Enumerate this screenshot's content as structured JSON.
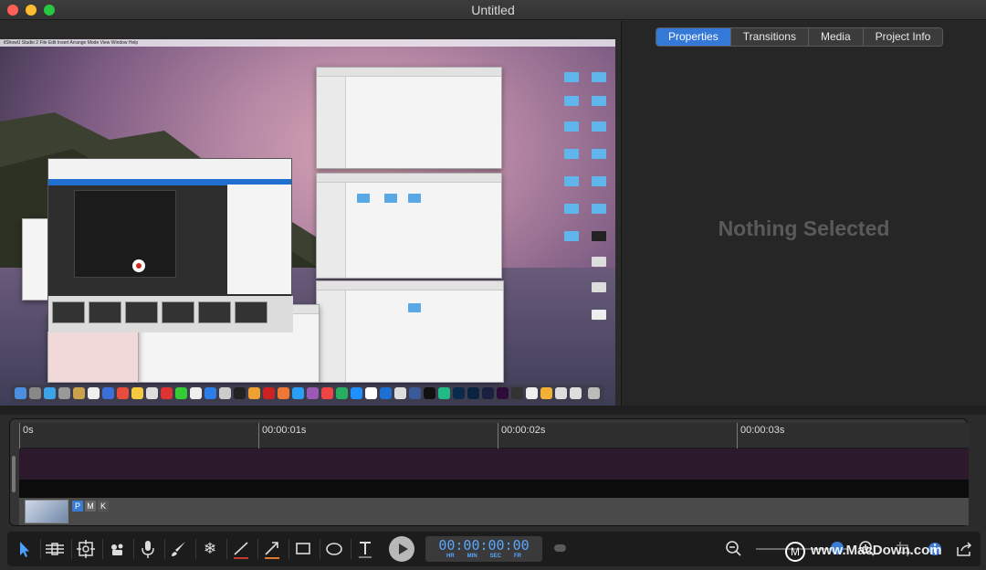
{
  "window": {
    "title": "Untitled"
  },
  "preview": {
    "menubar_text": "ilShowU Studio 2  File  Edit  Insert  Arrange  Mode  View  Window  Help"
  },
  "inspector": {
    "tabs": [
      {
        "label": "Properties",
        "active": true
      },
      {
        "label": "Transitions",
        "active": false
      },
      {
        "label": "Media",
        "active": false
      },
      {
        "label": "Project Info",
        "active": false
      }
    ],
    "empty_message": "Nothing Selected"
  },
  "timeline": {
    "ticks": [
      "0s",
      "00:00:01s",
      "00:00:02s",
      "00:00:03s"
    ],
    "clip_badges": [
      "P",
      "M",
      "K"
    ]
  },
  "toolbar": {
    "timecode": "00:00:00:00",
    "timecode_units": [
      "HR",
      "MIN",
      "SEC",
      "FR"
    ],
    "tools": [
      "pointer-icon",
      "trim-icon",
      "zoom-region-icon",
      "camera-effects-icon",
      "microphone-icon",
      "brush-icon",
      "freeze-icon",
      "line-icon",
      "arrow-icon",
      "rectangle-icon",
      "ellipse-icon",
      "text-icon"
    ],
    "line_color": "#c0392b",
    "arrow_color": "#e07a2a"
  },
  "watermark": {
    "logo": "M",
    "text": "www.MacDown.com"
  },
  "colors": {
    "accent": "#3478d8",
    "timecode": "#5aa6ff"
  }
}
